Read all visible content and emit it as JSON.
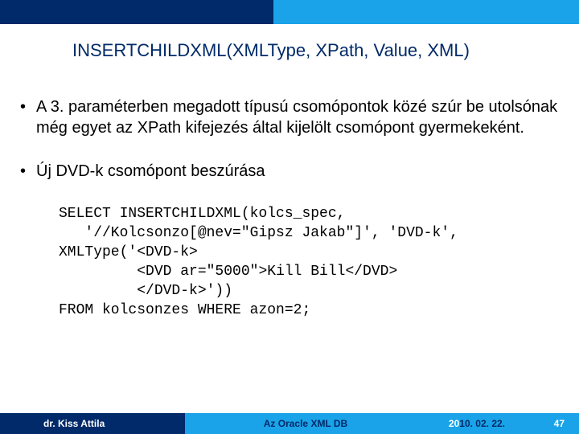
{
  "title": "INSERTCHILDXML(XMLType, XPath, Value, XML)",
  "bullets": {
    "b1": "A 3. paraméterben megadott típusú csomópontok közé szúr be utolsónak még egyet az XPath kifejezés által kijelölt csomópont gyermekeként.",
    "b2": "Új DVD-k csomópont beszúrása"
  },
  "code": {
    "l1": "SELECT INSERTCHILDXML(kolcs_spec,",
    "l2": "   '//Kolcsonzo[@nev=\"Gipsz Jakab\"]', 'DVD-k',",
    "l3": "XMLType('<DVD-k>",
    "l4": "         <DVD ar=\"5000\">Kill Bill</DVD>",
    "l5": "         </DVD-k>'))",
    "l6": "FROM kolcsonzes WHERE azon=2;"
  },
  "footer": {
    "author": "dr. Kiss Attila",
    "subject": "Az Oracle XML DB",
    "date_year_prefix": "20",
    "date_rest": "10. 02. 22.",
    "page": "47"
  }
}
